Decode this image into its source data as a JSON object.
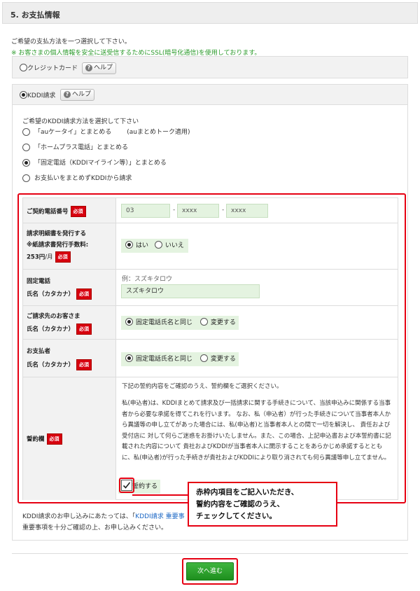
{
  "section": {
    "title": "5. お支払情報"
  },
  "intro": {
    "line1": "ご希望の支払方法を一つ選択して下さい。",
    "line2": "※ お客さまの個人情報を安全に送受信するためにSSL(暗号化通信)を使用しております。"
  },
  "payment_options": {
    "credit": {
      "label": "クレジットカード",
      "help": "ヘルプ"
    },
    "kddi": {
      "label": "KDDI請求",
      "help": "ヘルプ",
      "selected": true
    }
  },
  "kddi_methods": {
    "prompt": "ご希望のKDDI請求方法を選択して下さい",
    "options": [
      {
        "label": "「auケータイ」とまとめる",
        "note": "(auまとめトーク適用)",
        "selected": false
      },
      {
        "label": "「ホームプラス電話」とまとめる",
        "selected": false
      },
      {
        "label": "「固定電話（KDDIマイライン等）」とまとめる",
        "selected": true
      },
      {
        "label": "お支払いをまとめずKDDIから請求",
        "selected": false
      }
    ]
  },
  "form": {
    "required_label": "必須",
    "phone": {
      "label": "ご契約電話番号",
      "part1": "03",
      "part2": "xxxx",
      "part3": "xxxx",
      "dash": "-"
    },
    "invoice": {
      "label1": "請求明細書を発行する",
      "label2": "※紙請求書発行手数料:",
      "fee": "253円",
      "fee_unit": "/月",
      "yes": "はい",
      "no": "いいえ"
    },
    "landline": {
      "label1": "固定電話",
      "label2": "氏名（カタカナ）",
      "example": "例：スズキタロウ",
      "value": "スズキタロウ"
    },
    "billing_customer": {
      "label1": "ご請求先のお客さま",
      "label2": "氏名（カタカナ）",
      "same": "固定電話氏名と同じ",
      "change": "変更する"
    },
    "payer": {
      "label1": "お支払者",
      "label2": "氏名（カタカナ）",
      "same": "固定電話氏名と同じ",
      "change": "変更する"
    },
    "pledge": {
      "label": "誓約欄",
      "intro": "下記の誓約内容をご確認のうえ、誓約欄をご選択ください。",
      "body": "私(申込者)は、KDDIまとめて請求及び一括請求に関する手続きについて、当該申込みに関係する当事者から必要な承諾を得てこれを行います。 なお、私（申込者）が行った手続きについて当事者本人から異議等の申し立てがあった場合には、私(申込者)と当事者本人との間で一切を解決し、 責任および受付店に 対して何らご迷惑をお掛けいたしません。また、この場合、上記申込書および本誓約書に記載された内容について 貴社およびKDDIが当事者本人に開示することをあらかじめ承諾するとともに、私(申込者)が行った手続きが貴社およびKDDIにより取り消されても何ら異議等申し立てません。",
      "checkbox": "誓約する",
      "checked": true
    }
  },
  "notice": {
    "line1_prefix": "KDDI請求のお申し込みにあたっては、「",
    "link": "KDDI請求 重要事",
    "line2": "重要事項を十分ご確認の上、お申し込みください。"
  },
  "callout": {
    "line1": "赤枠内項目をご記入いただき、",
    "line2": "誓約内容をご確認のうえ、",
    "line3": "チェックしてください。"
  },
  "next_button": {
    "label": "次へ進む"
  },
  "colors": {
    "accent_red": "#e60012",
    "green_button": "#2a9f2a",
    "field_green": "#e4f3e0",
    "required_red": "#d7000f"
  }
}
